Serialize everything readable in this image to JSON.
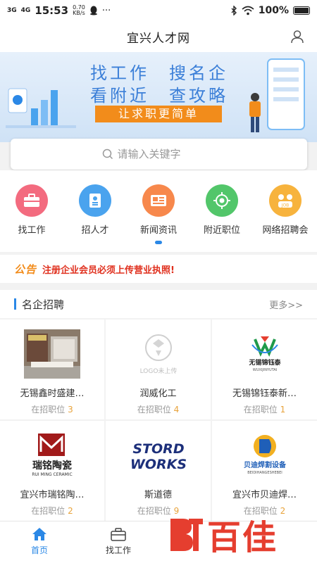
{
  "status_bar": {
    "network_1": "3G",
    "network_2": "4G",
    "time": "15:53",
    "speed_value": "0.70",
    "speed_unit": "KB/s",
    "more": "···",
    "battery_pct": "100%"
  },
  "header": {
    "title": "宜兴人才网",
    "user_icon": "user-icon"
  },
  "banner": {
    "line1": "找工作　搜名企",
    "line2": "看附近　查攻略",
    "slogan": "让求职更简单"
  },
  "search": {
    "placeholder": "请输入关键字"
  },
  "quick_nav": {
    "items": [
      {
        "label": "找工作",
        "icon": "briefcase-icon",
        "color": "#f36b7f"
      },
      {
        "label": "招人才",
        "icon": "resume-icon",
        "color": "#4aa3ee"
      },
      {
        "label": "新闻资讯",
        "icon": "news-icon",
        "color": "#f7884c"
      },
      {
        "label": "附近职位",
        "icon": "location-target-icon",
        "color": "#52c66a"
      },
      {
        "label": "网络招聘会",
        "icon": "job-fair-icon",
        "color": "#f7b33d"
      }
    ]
  },
  "notice": {
    "tag": "公告",
    "text": "注册企业会员必须上传营业执照!"
  },
  "section": {
    "title": "名企招聘",
    "more": "更多>>"
  },
  "companies": [
    {
      "name": "无锡鑫时盛建…",
      "jobs_label": "在招职位",
      "jobs": "3"
    },
    {
      "name": "润威化工",
      "jobs_label": "在招职位",
      "jobs": "4",
      "logo_placeholder": "LOGO未上传"
    },
    {
      "name": "无锡锦钰泰新…",
      "jobs_label": "在招职位",
      "jobs": "1",
      "logo_text": "无锡锦钰泰",
      "logo_sub": "WUXIJINYUTAI"
    },
    {
      "name": "宜兴市瑞铭陶…",
      "jobs_label": "在招职位",
      "jobs": "2",
      "logo_text": "瑞铭陶瓷",
      "logo_sub": "RUI MING CERAMIC"
    },
    {
      "name": "斯道德",
      "jobs_label": "在招职位",
      "jobs": "9",
      "logo_text_1": "STORD",
      "logo_text_2": "WORKS"
    },
    {
      "name": "宜兴市贝迪焊…",
      "jobs_label": "在招职位",
      "jobs": "2",
      "logo_text": "贝迪焊割设备",
      "logo_sub": "BEIDIHANGESHEBEI"
    }
  ],
  "tabbar": {
    "tabs": [
      {
        "label": "首页",
        "icon": "home-icon",
        "active": true
      },
      {
        "label": "找工作",
        "icon": "briefcase-icon",
        "active": false
      }
    ]
  },
  "watermark": {
    "text": "百佳"
  },
  "colors": {
    "accent": "#2b88e6",
    "notice_red": "#e0301e",
    "orange": "#f28c1b"
  }
}
